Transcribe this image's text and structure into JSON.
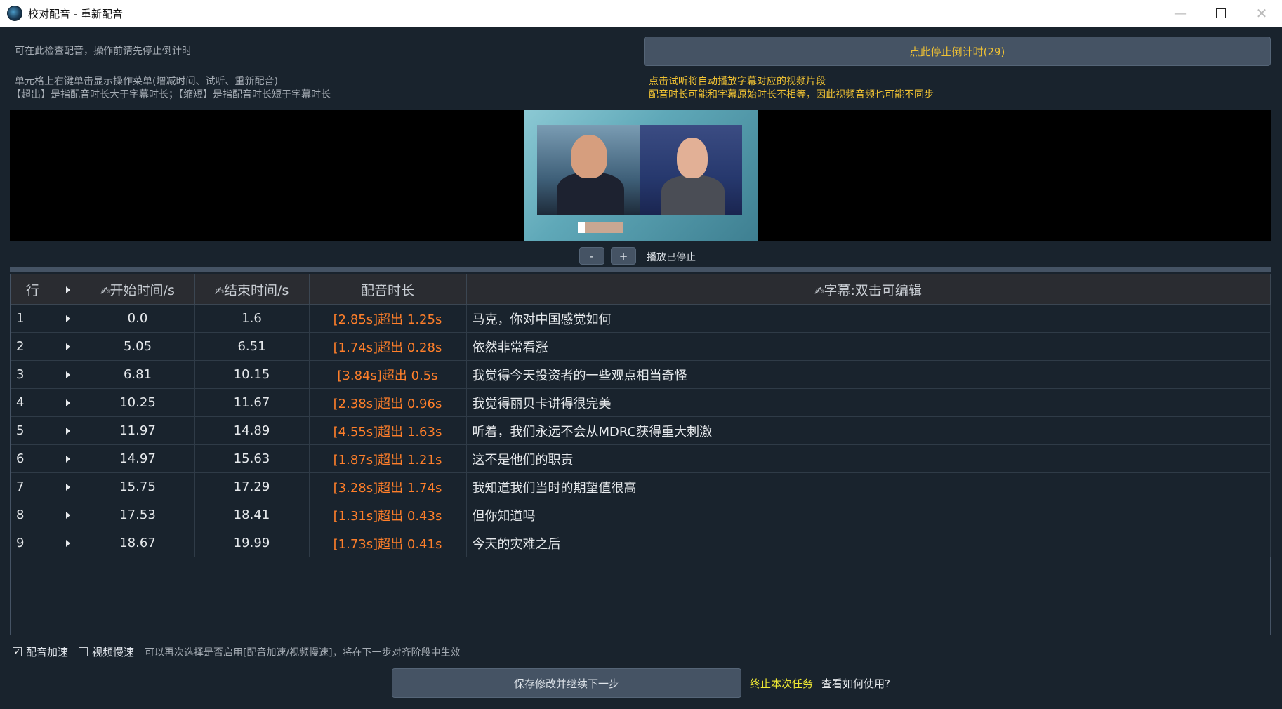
{
  "window": {
    "title": "校对配音 - 重新配音",
    "controls": {
      "minimize": "—",
      "close": "✕"
    }
  },
  "hints": {
    "line1": "可在此检查配音，操作前请先停止倒计时",
    "line2": "单元格上右键单击显示操作菜单(增减时间、试听、重新配音)",
    "line3": "【超出】是指配音时长大于字幕时长；【缩短】是指配音时长短于字幕时长"
  },
  "notices": {
    "line1": "点击试听将自动播放字幕对应的视频片段",
    "line2": "配音时长可能和字幕原始时长不相等，因此视频音频也可能不同步"
  },
  "stop_button": "点此停止倒计时(29)",
  "player": {
    "minus_label": "-",
    "plus_label": "+",
    "status": "播放已停止"
  },
  "table": {
    "headers": {
      "row": "行",
      "play": "",
      "start": "开始时间/s",
      "end": "结束时间/s",
      "duration": "配音时长",
      "subtitle": "字幕:双击可编辑"
    },
    "edit_icon": "✍",
    "rows": [
      {
        "row": "1",
        "start": "0.0",
        "end": "1.6",
        "duration": "[2.85s]超出 1.25s",
        "subtitle": "马克，你对中国感觉如何"
      },
      {
        "row": "2",
        "start": "5.05",
        "end": "6.51",
        "duration": "[1.74s]超出 0.28s",
        "subtitle": "依然非常看涨"
      },
      {
        "row": "3",
        "start": "6.81",
        "end": "10.15",
        "duration": "[3.84s]超出 0.5s",
        "subtitle": "我觉得今天投资者的一些观点相当奇怪"
      },
      {
        "row": "4",
        "start": "10.25",
        "end": "11.67",
        "duration": "[2.38s]超出 0.96s",
        "subtitle": "我觉得丽贝卡讲得很完美"
      },
      {
        "row": "5",
        "start": "11.97",
        "end": "14.89",
        "duration": "[4.55s]超出 1.63s",
        "subtitle": "听着，我们永远不会从MDRC获得重大刺激"
      },
      {
        "row": "6",
        "start": "14.97",
        "end": "15.63",
        "duration": "[1.87s]超出 1.21s",
        "subtitle": "这不是他们的职责"
      },
      {
        "row": "7",
        "start": "15.75",
        "end": "17.29",
        "duration": "[3.28s]超出 1.74s",
        "subtitle": "我知道我们当时的期望值很高"
      },
      {
        "row": "8",
        "start": "17.53",
        "end": "18.41",
        "duration": "[1.31s]超出 0.43s",
        "subtitle": "但你知道吗"
      },
      {
        "row": "9",
        "start": "18.67",
        "end": "19.99",
        "duration": "[1.73s]超出 0.41s",
        "subtitle": "今天的灾难之后"
      }
    ]
  },
  "footer": {
    "voice_speedup": {
      "label": "配音加速",
      "checked": true,
      "mark": "✓"
    },
    "video_slowdown": {
      "label": "视频慢速",
      "checked": false
    },
    "note": "可以再次选择是否启用[配音加速/视频慢速]，将在下一步对齐阶段中生效",
    "save_button": "保存修改并继续下一步",
    "abort_link": "终止本次任务",
    "help_link": "查看如何使用?"
  },
  "colors": {
    "background": "#19232d",
    "button": "#455364",
    "accent_yellow": "#f0c233",
    "duration_orange": "#ff7f2a"
  }
}
